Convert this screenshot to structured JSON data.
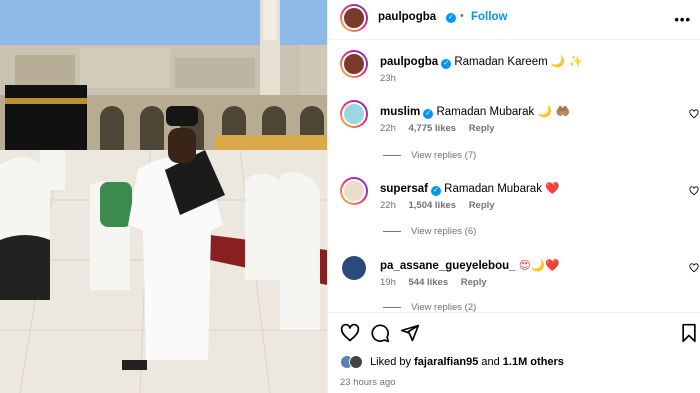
{
  "header": {
    "username": "paulpogba",
    "separator": "•",
    "follow_label": "Follow",
    "more_icon": "more-horizontal-icon"
  },
  "caption": {
    "username": "paulpogba",
    "text": "Ramadan Kareem",
    "emoji": "🌙 ✨",
    "time": "23h"
  },
  "comments": [
    {
      "username": "muslim",
      "text": "Ramadan Mubarak",
      "emoji": "🌙 🤲🏽",
      "time": "22h",
      "likes": "4,775 likes",
      "reply_label": "Reply",
      "view_replies": "View replies (7)"
    },
    {
      "username": "supersaf",
      "text": "Ramadan Mubarak",
      "emoji": "❤️",
      "time": "22h",
      "likes": "1,504 likes",
      "reply_label": "Reply",
      "view_replies": "View replies (6)"
    },
    {
      "username": "pa_assane_gueyelebou_",
      "text": "",
      "emoji": "😍🌙❤️",
      "time": "19h",
      "likes": "544 likes",
      "reply_label": "Reply",
      "view_replies": "View replies (2)"
    }
  ],
  "actions": {
    "icons": [
      "heart-icon",
      "comment-icon",
      "share-icon",
      "bookmark-icon"
    ]
  },
  "likes": {
    "prefix": "Liked by",
    "user": "fajaralfian95",
    "joiner": "and",
    "others": "1.1M others"
  },
  "posted": "23 hours ago",
  "colors": {
    "accent": "#0095f6",
    "muted": "#737373",
    "heart_red": "#ed4956"
  }
}
